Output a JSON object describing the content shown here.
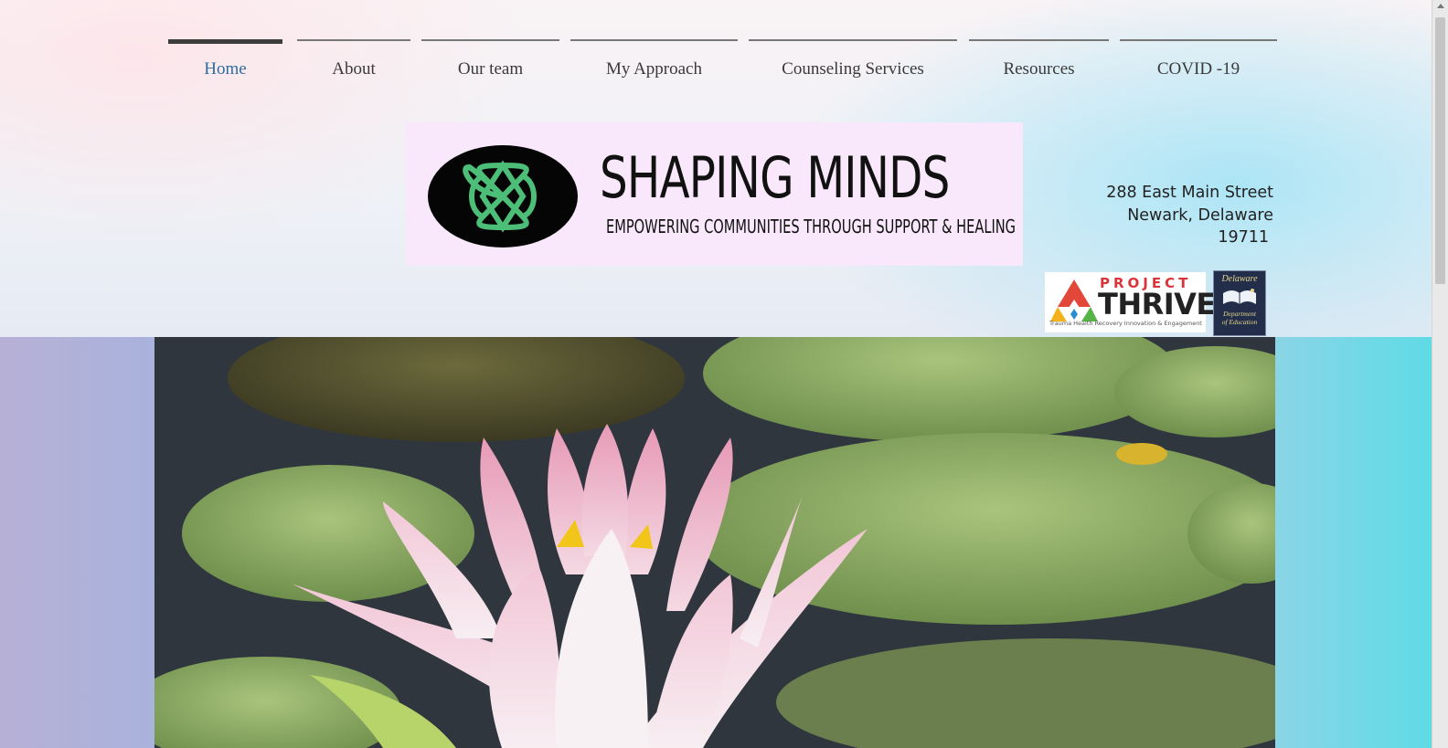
{
  "nav": {
    "items": [
      {
        "label": "Home",
        "active": true
      },
      {
        "label": "About"
      },
      {
        "label": "Our team"
      },
      {
        "label": "My Approach"
      },
      {
        "label": "Counseling Services"
      },
      {
        "label": "Resources"
      },
      {
        "label": "COVID -19"
      }
    ]
  },
  "brand": {
    "title": "SHAPING MINDS",
    "tagline": "EMPOWERING COMMUNITIES THROUGH SUPPORT & HEALING",
    "logo_icon": "interlocking-hearts-icon",
    "logo_colors": {
      "oval": "#050505",
      "mark": "#4cbe78",
      "panel": "#f9e8fb"
    }
  },
  "address": {
    "line1": "288 East Main Street",
    "line2": "Newark, Delaware",
    "line3": "19711"
  },
  "partners": {
    "thrive": {
      "project": "PROJECT",
      "name": "THRIVE",
      "subtitle": "Trauma Health Recovery Innovation & Engagement"
    },
    "doe": {
      "state": "Delaware",
      "line1": "Department",
      "line2": "of Education"
    }
  },
  "hero": {
    "image": "pink-water-lily-on-pond-photo"
  },
  "colors": {
    "nav_active": "#2c6ea0",
    "nav_text": "#3a3a3a"
  }
}
